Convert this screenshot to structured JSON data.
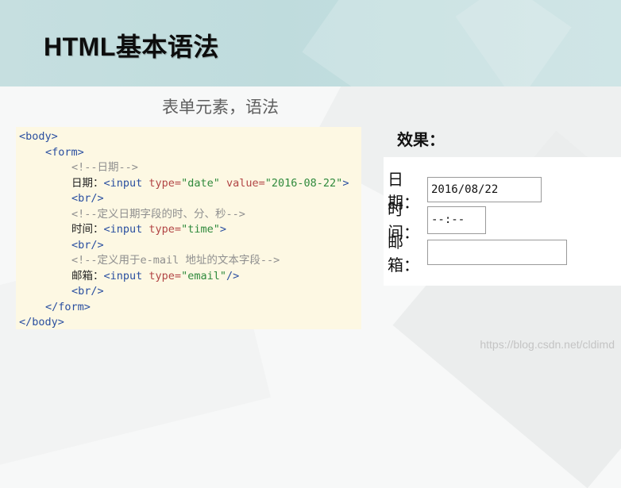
{
  "slide": {
    "title": "HTML基本语法",
    "subtitle": "表单元素，语法",
    "watermark": "https://blog.csdn.net/cldimd"
  },
  "code": {
    "l1": "<body>",
    "l2": "<form>",
    "l3": "<!--日期-->",
    "l4": {
      "label": "日期：",
      "tag_open": "<input",
      "attr1": "type=",
      "val1": "\"date\"",
      "attr2": "value=",
      "val2": "\"2016-08-22\"",
      "tag_close": ">"
    },
    "l5": "<br/>",
    "l6": "<!--定义日期字段的时、分、秒-->",
    "l7": {
      "label": "时间：",
      "tag_open": "<input",
      "attr1": "type=",
      "val1": "\"time\"",
      "tag_close": ">"
    },
    "l8": "<br/>",
    "l9": "<!--定义用于e-mail 地址的文本字段-->",
    "l10": {
      "label": "邮箱：",
      "tag_open": "<input",
      "attr1": "type=",
      "val1": "\"email\"",
      "tag_close": "/>"
    },
    "l11": "<br/>",
    "l12": "</form>",
    "l13": "</body>"
  },
  "effect": {
    "heading": "效果：",
    "date": {
      "label": "日期：",
      "value": "2016/08/22"
    },
    "time": {
      "label": "时间：",
      "value": "--:--"
    },
    "email": {
      "label": "邮箱：",
      "value": ""
    }
  }
}
